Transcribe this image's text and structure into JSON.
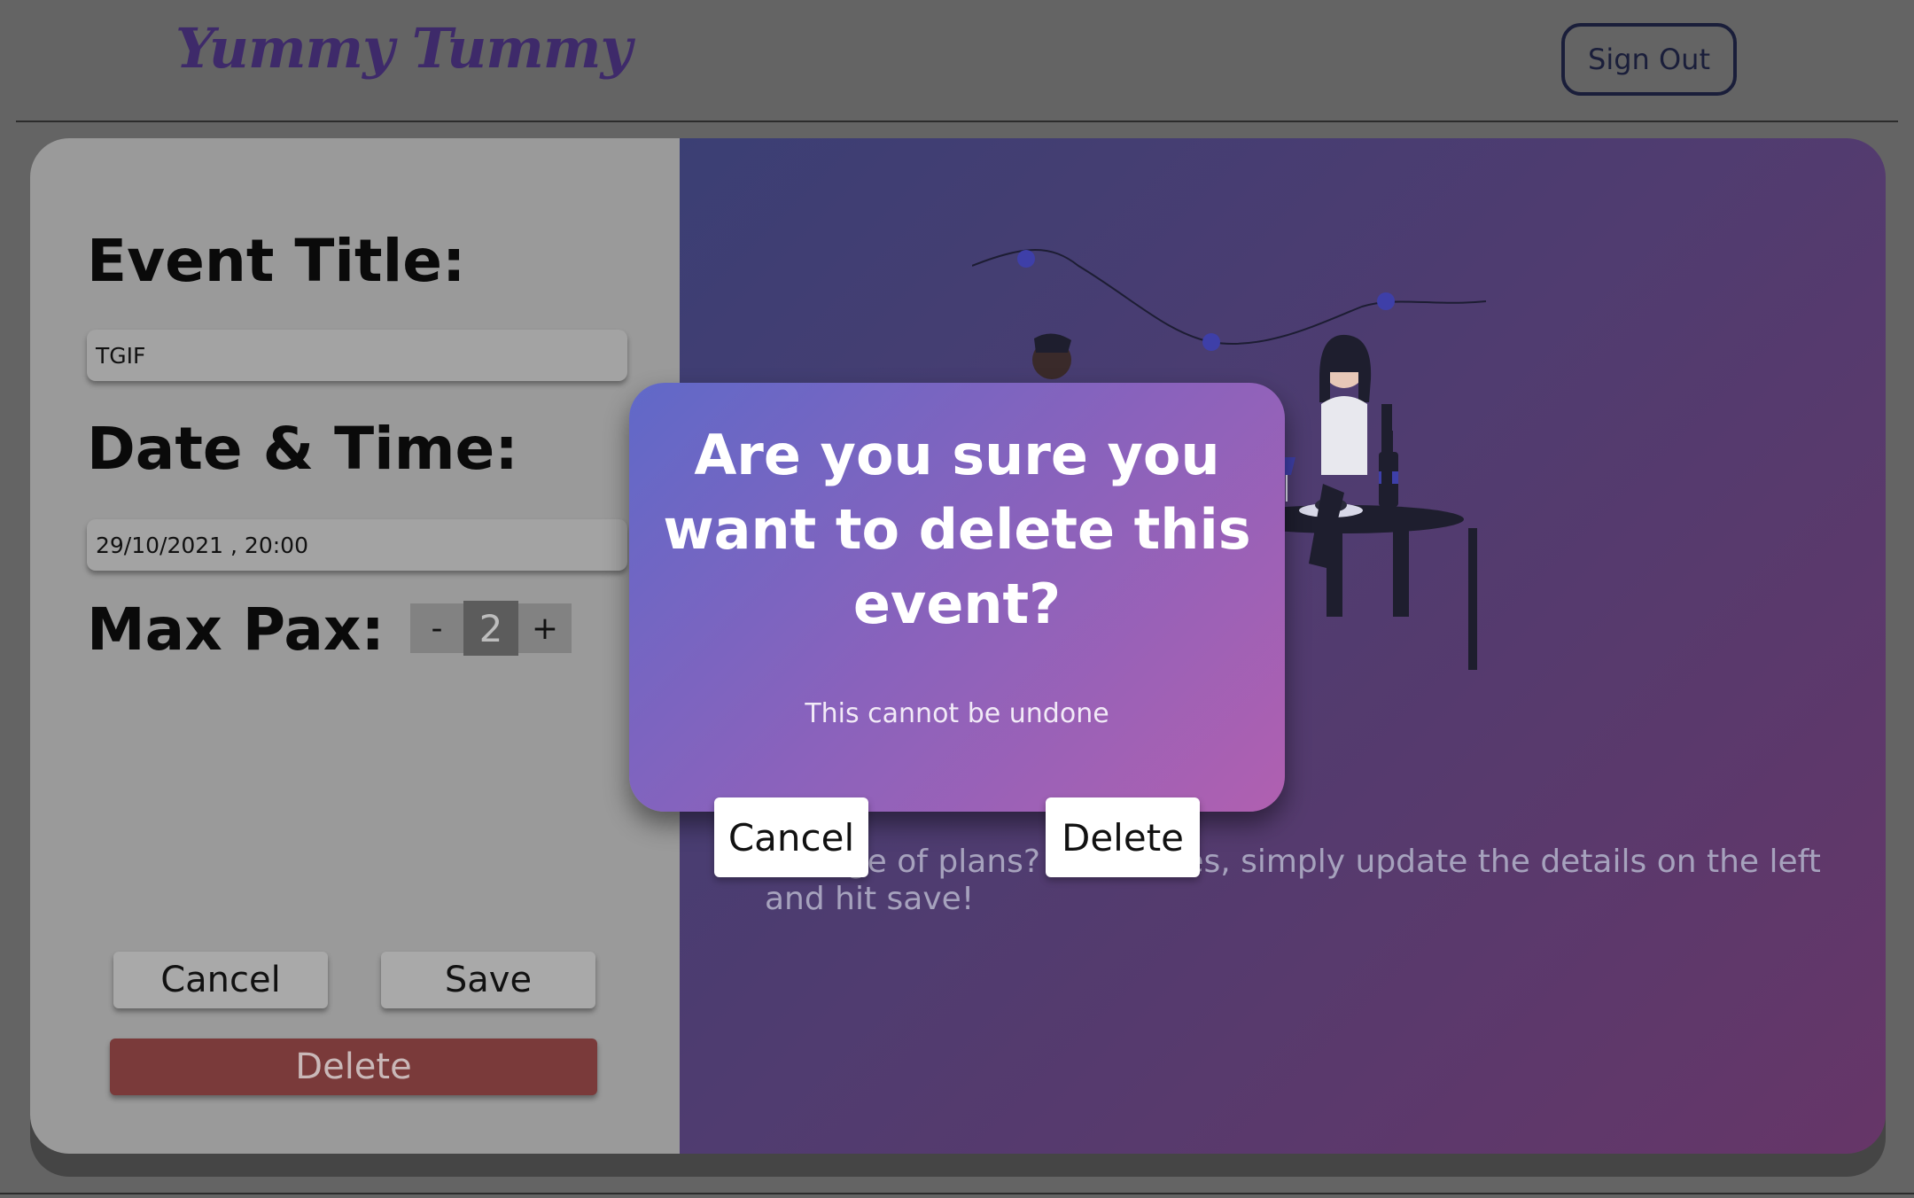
{
  "header": {
    "logo": "Yummy Tummy",
    "sign_out_label": "Sign Out"
  },
  "form": {
    "title_label": "Event Title:",
    "title_value": "TGIF",
    "date_label": "Date & Time:",
    "date_value": "29/10/2021 , 20:00",
    "pax_label": "Max Pax:",
    "pax_decrement": "-",
    "pax_value": "2",
    "pax_increment": "+",
    "cancel_label": "Cancel",
    "save_label": "Save",
    "delete_label": "Delete"
  },
  "right_panel": {
    "message": "Change of plans? No worries, simply update the details on the left and hit save!"
  },
  "modal": {
    "title": "Are you sure you want to delete this event?",
    "subtitle": "This cannot be undone",
    "cancel_label": "Cancel",
    "delete_label": "Delete"
  },
  "colors": {
    "overlay": "#646464",
    "modal_gradient_start": "#6069c8",
    "modal_gradient_end": "#b060b0",
    "delete_button": "#7a3a3a",
    "logo": "#3e2a6a"
  }
}
